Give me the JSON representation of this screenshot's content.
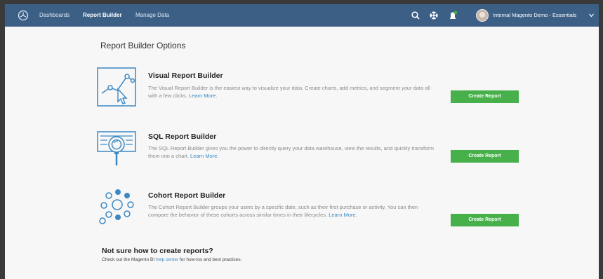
{
  "nav": {
    "items": [
      {
        "label": "Dashboards",
        "active": false
      },
      {
        "label": "Report Builder",
        "active": true
      },
      {
        "label": "Manage Data",
        "active": false
      }
    ],
    "account_label": "Internal Magento Demo - Essentials",
    "icons": [
      "search-icon",
      "help-icon",
      "notification-icon",
      "avatar",
      "chevron-down-icon"
    ]
  },
  "main": {
    "title": "Report Builder Options",
    "options": [
      {
        "title": "Visual Report Builder",
        "description": "The Visual Report Builder is the easiest way to visualize your data. Create charts, add metrics, and segment your data all with a few clicks.",
        "link": "Learn More.",
        "button": "Create Report",
        "icon": "line-chart-cursor-icon"
      },
      {
        "title": "SQL Report Builder",
        "description": "The SQL Report Builder gives you the power to directly query your data warehouse, view the results, and quickly transform them into a chart.",
        "link": "Learn More.",
        "button": "Create Report",
        "icon": "database-magnifier-icon"
      },
      {
        "title": "Cohort Report Builder",
        "description": "The Cohort Report Builder groups your users by a specific date, such as their first purchase or activity. You can then compare the behavior of these cohorts across similar times in their lifecycles.",
        "link": "Learn More.",
        "button": "Create Report",
        "icon": "cohort-circles-icon"
      }
    ],
    "help": {
      "title": "Not sure how to create reports?",
      "prefix": "Check out the Magento BI ",
      "link": "help center",
      "suffix": " for how-tos and best practices."
    }
  },
  "colors": {
    "nav_bg": "#3c5f86",
    "accent_blue": "#3b88c4",
    "button_green": "#47b04b"
  }
}
